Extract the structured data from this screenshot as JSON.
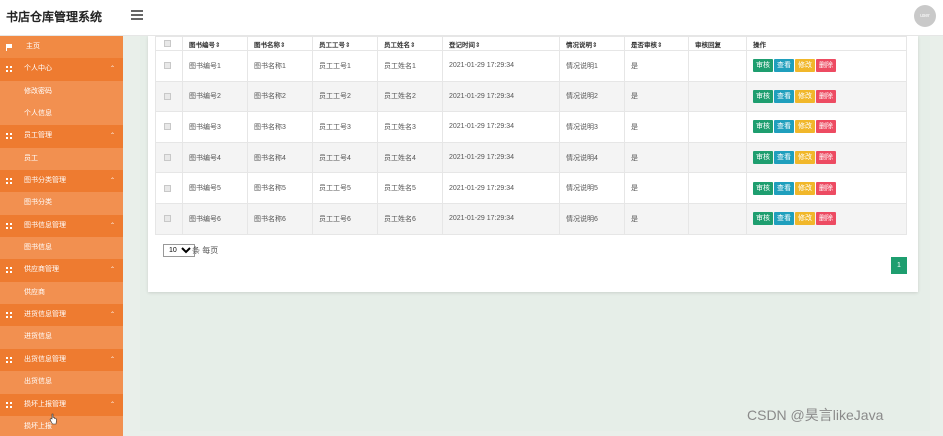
{
  "app": {
    "title": "书店仓库管理系统",
    "avatar_text": "user"
  },
  "sidebar": {
    "items": [
      {
        "label": "主页",
        "type": "home"
      },
      {
        "label": "个人中心",
        "type": "group"
      },
      {
        "label": "修改密码",
        "type": "sub"
      },
      {
        "label": "个人信息",
        "type": "sub"
      },
      {
        "label": "员工管理",
        "type": "group"
      },
      {
        "label": "员工",
        "type": "sub"
      },
      {
        "label": "图书分类管理",
        "type": "group"
      },
      {
        "label": "图书分类",
        "type": "sub"
      },
      {
        "label": "图书信息管理",
        "type": "group"
      },
      {
        "label": "图书信息",
        "type": "sub"
      },
      {
        "label": "供应商管理",
        "type": "group"
      },
      {
        "label": "供应商",
        "type": "sub"
      },
      {
        "label": "进货信息管理",
        "type": "group"
      },
      {
        "label": "进货信息",
        "type": "sub"
      },
      {
        "label": "出货信息管理",
        "type": "group"
      },
      {
        "label": "出货信息",
        "type": "sub"
      },
      {
        "label": "损坏上报管理",
        "type": "group"
      },
      {
        "label": "损坏上报",
        "type": "sub"
      }
    ]
  },
  "table": {
    "headers": [
      "",
      "图书编号⇕",
      "图书名称⇕",
      "员工工号⇕",
      "员工姓名⇕",
      "登记时间⇕",
      "情况说明⇕",
      "是否审核⇕",
      "审核回复",
      "操作"
    ],
    "rows": [
      {
        "book_no": "图书编号1",
        "book_name": "图书名称1",
        "emp_no": "员工工号1",
        "emp_name": "员工姓名1",
        "time": "2021-01-29 17:29:34",
        "desc": "情况说明1",
        "audited": "是",
        "reply": ""
      },
      {
        "book_no": "图书编号2",
        "book_name": "图书名称2",
        "emp_no": "员工工号2",
        "emp_name": "员工姓名2",
        "time": "2021-01-29 17:29:34",
        "desc": "情况说明2",
        "audited": "是",
        "reply": ""
      },
      {
        "book_no": "图书编号3",
        "book_name": "图书名称3",
        "emp_no": "员工工号3",
        "emp_name": "员工姓名3",
        "time": "2021-01-29 17:29:34",
        "desc": "情况说明3",
        "audited": "是",
        "reply": ""
      },
      {
        "book_no": "图书编号4",
        "book_name": "图书名称4",
        "emp_no": "员工工号4",
        "emp_name": "员工姓名4",
        "time": "2021-01-29 17:29:34",
        "desc": "情况说明4",
        "audited": "是",
        "reply": ""
      },
      {
        "book_no": "图书编号5",
        "book_name": "图书名称5",
        "emp_no": "员工工号5",
        "emp_name": "员工姓名5",
        "time": "2021-01-29 17:29:34",
        "desc": "情况说明5",
        "audited": "是",
        "reply": ""
      },
      {
        "book_no": "图书编号6",
        "book_name": "图书名称6",
        "emp_no": "员工工号6",
        "emp_name": "员工姓名6",
        "time": "2021-01-29 17:29:34",
        "desc": "情况说明6",
        "audited": "是",
        "reply": ""
      }
    ],
    "actions": {
      "audit": "审核",
      "view": "查看",
      "edit": "修改",
      "delete": "删除"
    }
  },
  "pager": {
    "page_size": "10",
    "page_size_options": [
      "10"
    ],
    "per_page_label": "条 每页",
    "current_page": "1"
  },
  "watermark": "CSDN @昊言likeJava",
  "colors": {
    "sidebar": "#f0843c",
    "audit": "#1e9e6f",
    "view": "#1f9fbd",
    "edit": "#f1b72a",
    "delete": "#ed4b62"
  }
}
